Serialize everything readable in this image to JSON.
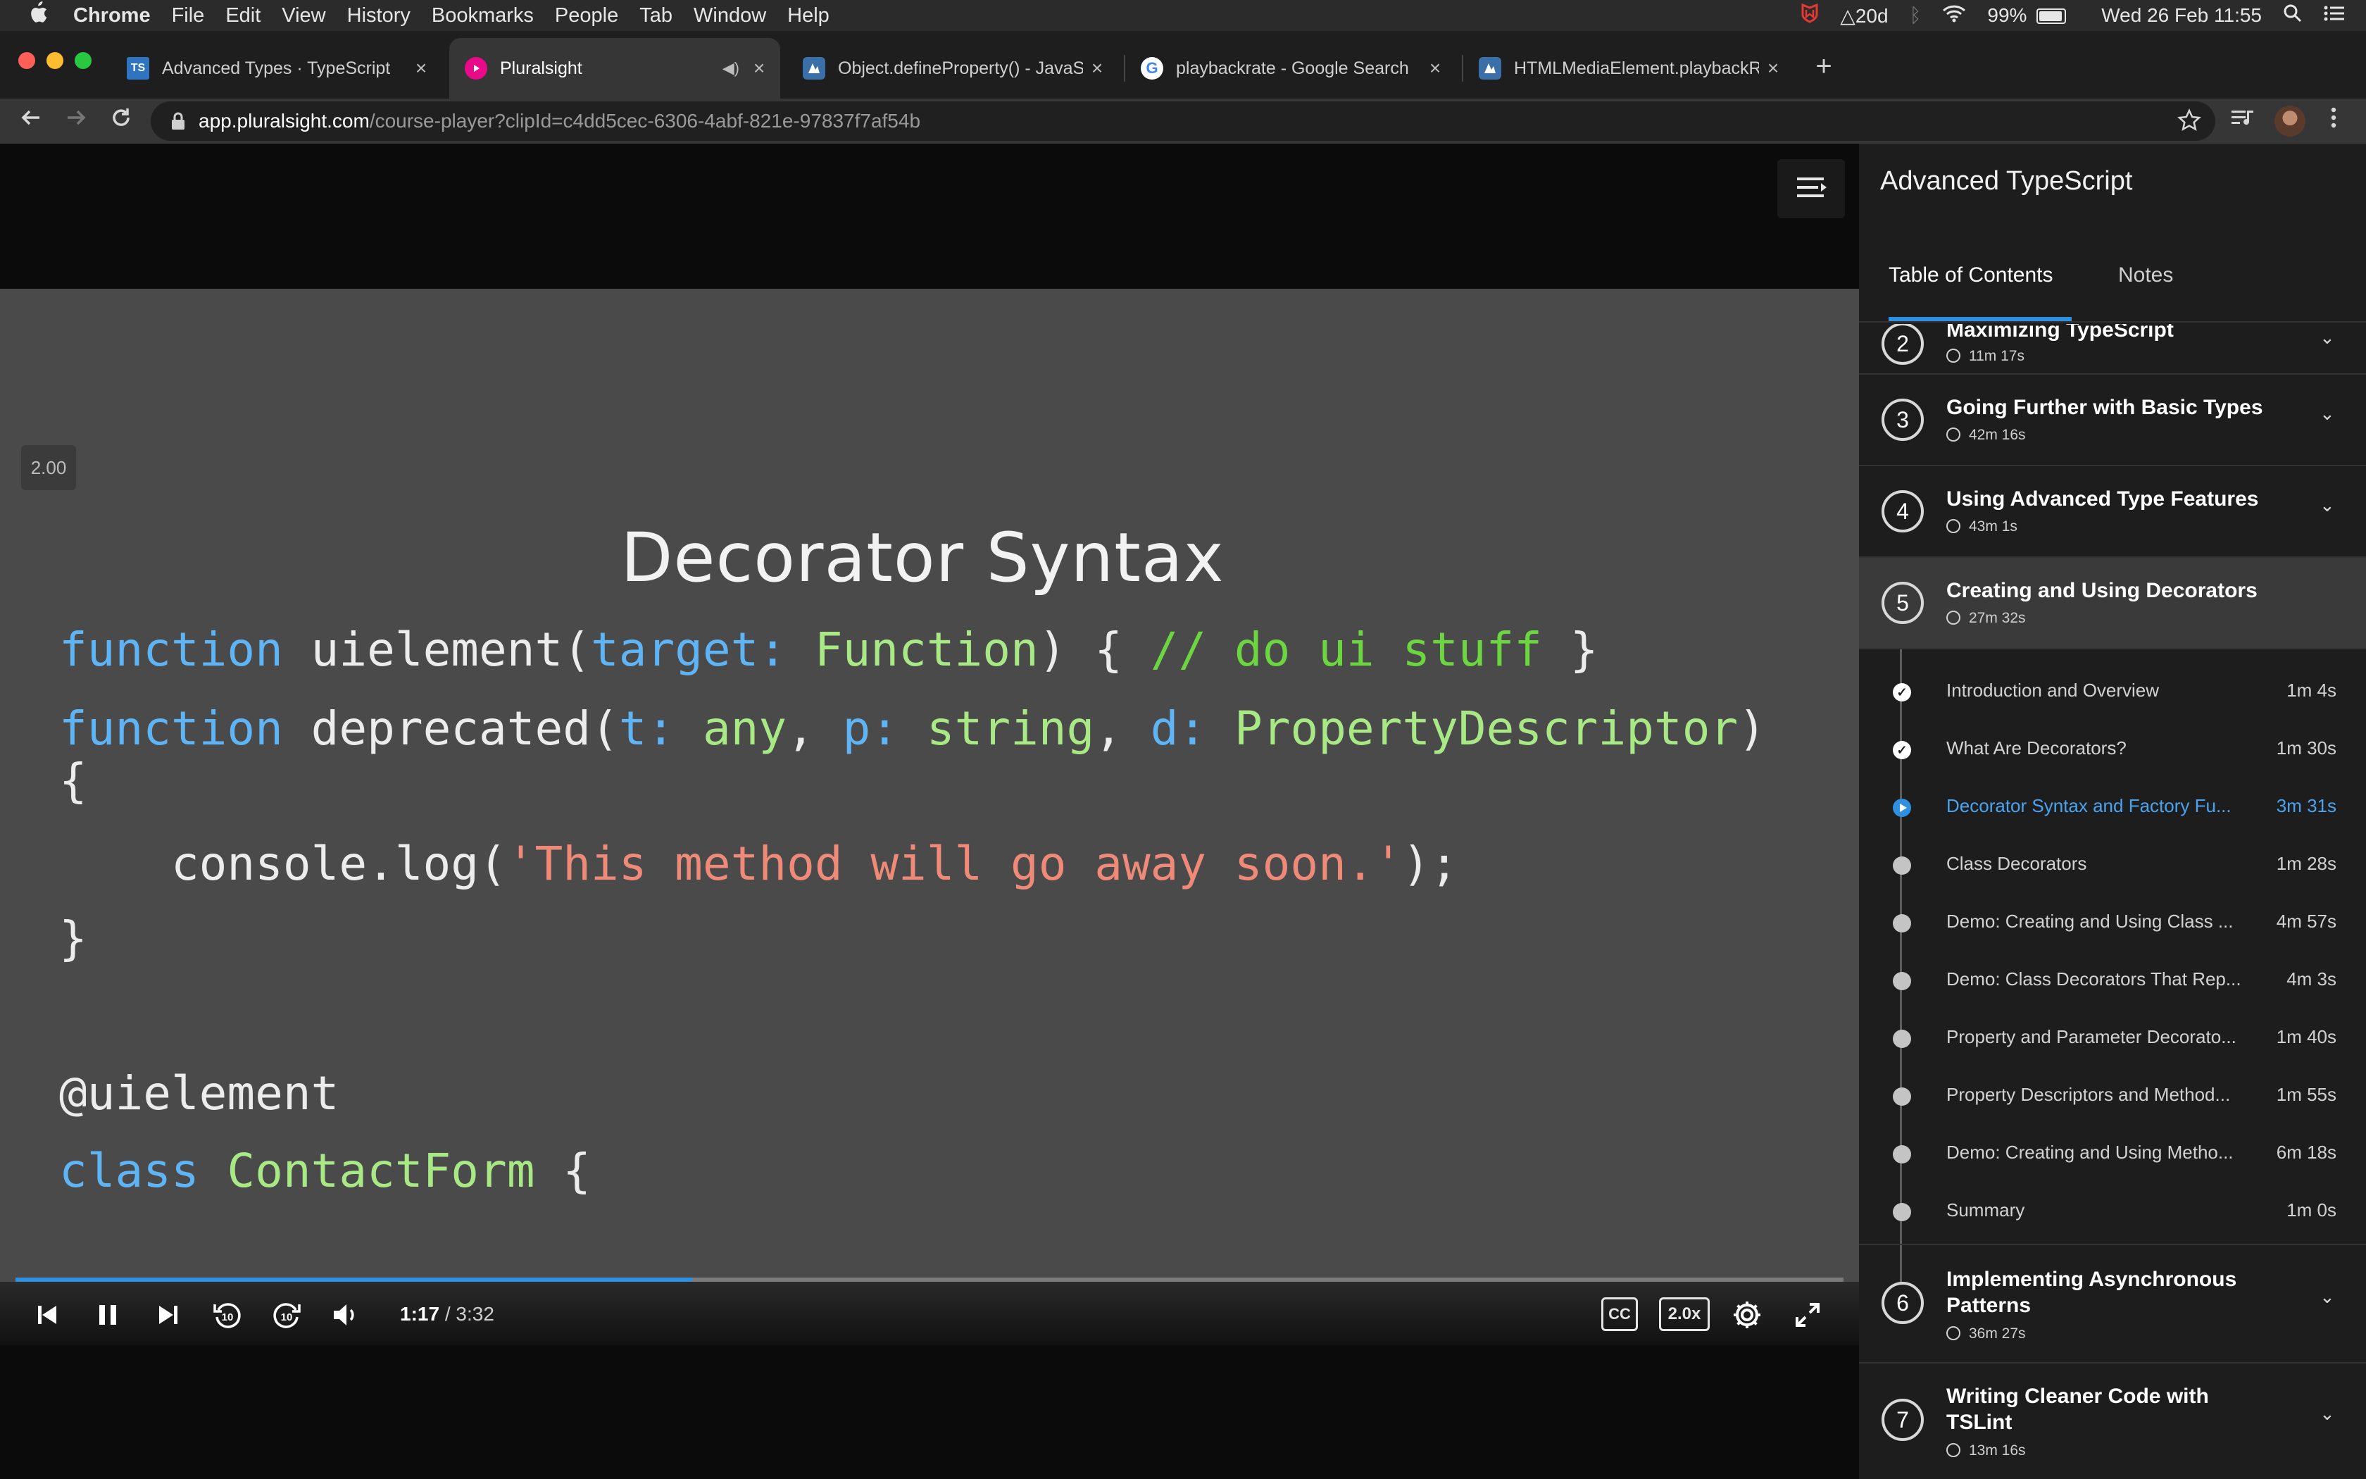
{
  "menubar": {
    "apple": "",
    "app": "Chrome",
    "items": [
      "File",
      "Edit",
      "View",
      "History",
      "Bookmarks",
      "People",
      "Tab",
      "Window",
      "Help"
    ],
    "status_badge": "20d",
    "battery": "99%",
    "datetime": "Wed 26 Feb  11:55"
  },
  "tabs": [
    {
      "title": "Advanced Types · TypeScript",
      "favicon": "TS",
      "color": "#2f74c0"
    },
    {
      "title": "Pluralsight",
      "favicon": "P",
      "color": "#e80a89"
    },
    {
      "title": "Object.defineProperty() - JavaScript",
      "favicon": "M",
      "color": "#3a6fa8"
    },
    {
      "title": "playbackrate - Google Search",
      "favicon": "G",
      "color": "#ffffff"
    },
    {
      "title": "HTMLMediaElement.playbackRate",
      "favicon": "M",
      "color": "#3a6fa8"
    }
  ],
  "address": {
    "host": "app.pluralsight.com",
    "path": "/course-player?clipId=c4dd5cec-6306-4abf-821e-97837f7af54b"
  },
  "player": {
    "speed_badge": "2.00",
    "slide_title": "Decorator Syntax",
    "progress": 0.37,
    "time_current": "1:17",
    "time_sep": " / ",
    "time_total": "3:32",
    "cc_label": "CC",
    "speed_label": "2.0x",
    "code": {
      "l1": {
        "kw": "function",
        "name": " uielement(",
        "param": "target:",
        "type": " Function",
        "rest": ") { ",
        "comment": "// do ui stuff",
        "end": " }"
      },
      "l2": {
        "kw": "function",
        "name": " deprecated(",
        "p1": "t:",
        "t1": " any",
        "c1": ", ",
        "p2": "p:",
        "t2": " string",
        "c2": ", ",
        "p3": "d:",
        "t3": " PropertyDescriptor",
        "end": ")"
      },
      "l3": "{",
      "l4": {
        "pre": "    console.log(",
        "str": "'This method will go away soon.'",
        "end": ");"
      },
      "l5": "}",
      "l6": "@uielement",
      "l7": {
        "kw": "class",
        "name": " ContactForm",
        "end": " {"
      },
      "l8": "}"
    }
  },
  "sidebar": {
    "course_title": "Advanced TypeScript",
    "tab_toc": "Table of Contents",
    "tab_notes": "Notes",
    "modules": [
      {
        "num": "2",
        "title": "Maximizing TypeScript",
        "duration": "11m 17s"
      },
      {
        "num": "3",
        "title": "Going Further with Basic Types",
        "duration": "42m 16s"
      },
      {
        "num": "4",
        "title": "Using Advanced Type Features",
        "duration": "43m 1s"
      },
      {
        "num": "5",
        "title": "Creating and Using Decorators",
        "duration": "27m 32s"
      },
      {
        "num": "6",
        "title": "Implementing Asynchronous Patterns",
        "duration": "36m 27s"
      },
      {
        "num": "7",
        "title": "Writing Cleaner Code with TSLint",
        "duration": "13m 16s"
      }
    ],
    "clips": [
      {
        "title": "Introduction and Overview",
        "duration": "1m 4s",
        "state": "done"
      },
      {
        "title": "What Are Decorators?",
        "duration": "1m 30s",
        "state": "done"
      },
      {
        "title": "Decorator Syntax and Factory Fu...",
        "duration": "3m 31s",
        "state": "current"
      },
      {
        "title": "Class Decorators",
        "duration": "1m 28s",
        "state": "todo"
      },
      {
        "title": "Demo: Creating and Using Class ...",
        "duration": "4m 57s",
        "state": "todo"
      },
      {
        "title": "Demo: Class Decorators That Rep...",
        "duration": "4m 3s",
        "state": "todo"
      },
      {
        "title": "Property and Parameter Decorato...",
        "duration": "1m 40s",
        "state": "todo"
      },
      {
        "title": "Property Descriptors and Method...",
        "duration": "1m 55s",
        "state": "todo"
      },
      {
        "title": "Demo: Creating and Using Metho...",
        "duration": "6m 18s",
        "state": "todo"
      },
      {
        "title": "Summary",
        "duration": "1m 0s",
        "state": "todo"
      }
    ]
  }
}
